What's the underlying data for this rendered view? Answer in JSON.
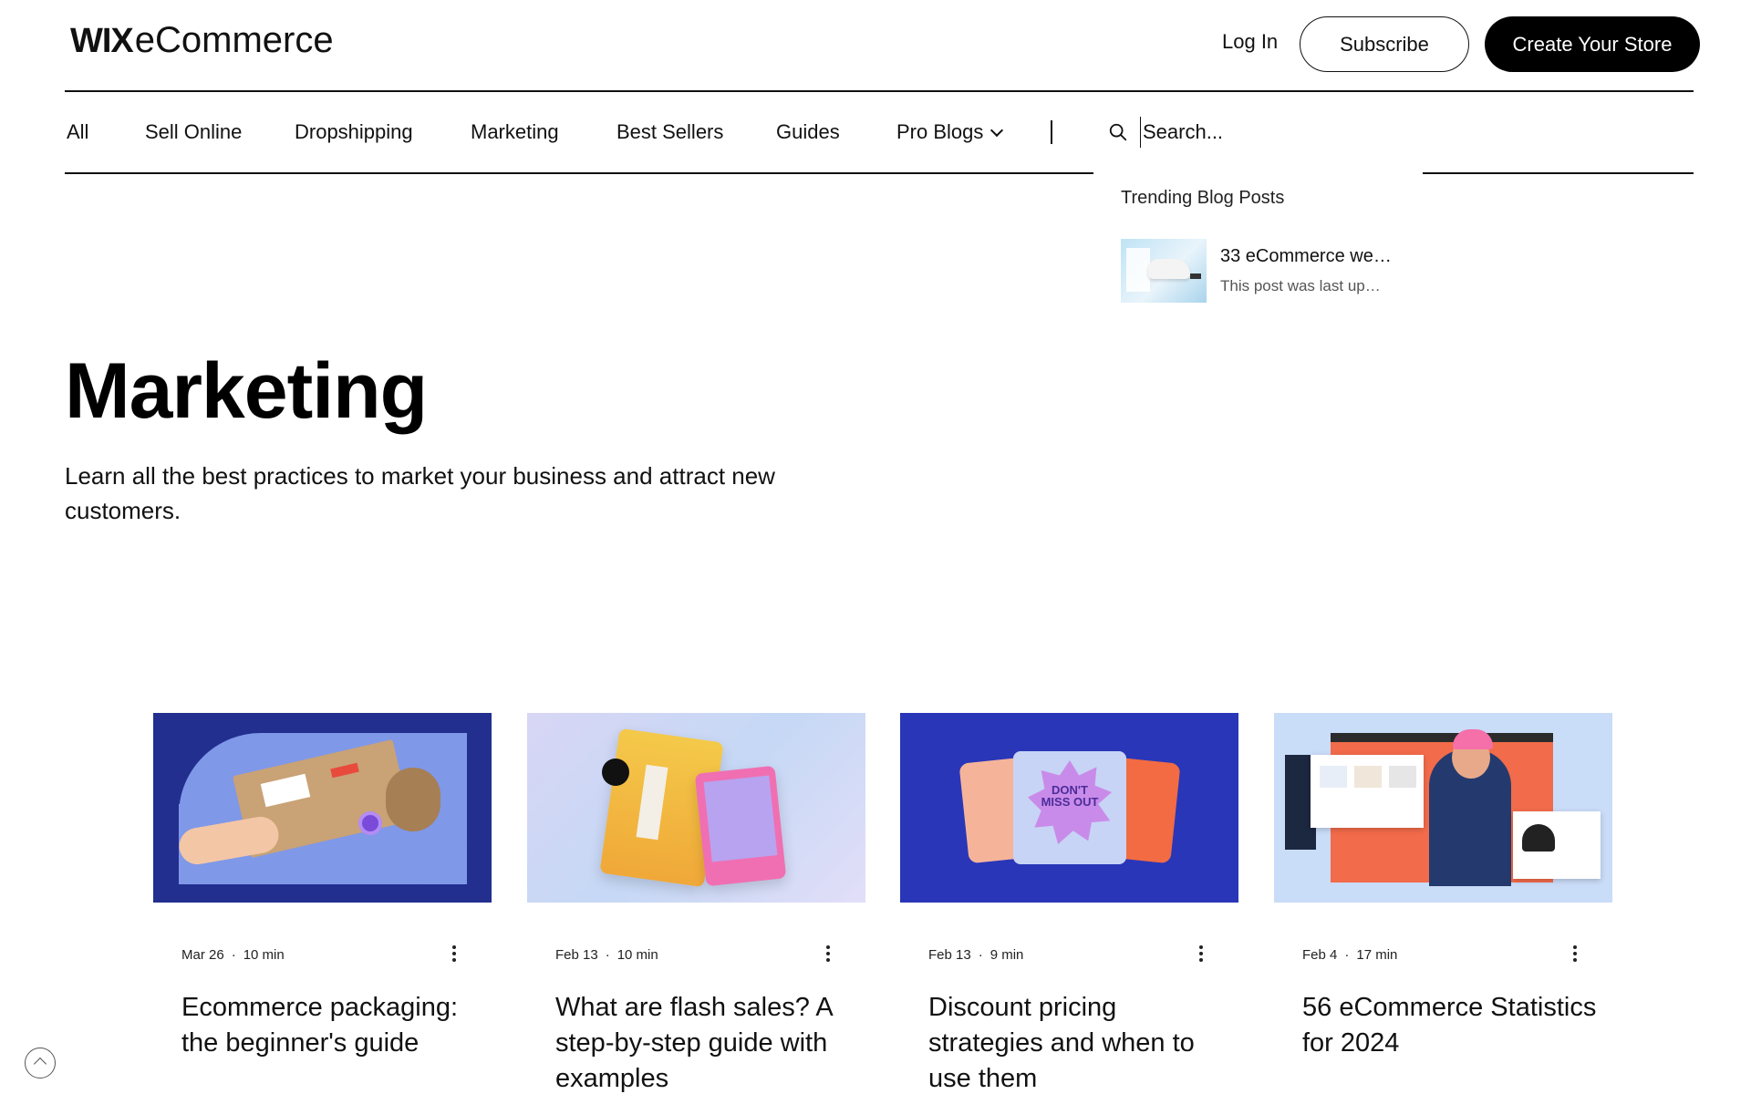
{
  "header": {
    "logo_wix": "WIX",
    "logo_ecommerce": "eCommerce",
    "login_label": "Log In",
    "subscribe_label": "Subscribe",
    "create_store_label": "Create Your Store"
  },
  "nav": {
    "items": [
      {
        "label": "All"
      },
      {
        "label": "Sell Online"
      },
      {
        "label": "Dropshipping"
      },
      {
        "label": "Marketing"
      },
      {
        "label": "Best Sellers"
      },
      {
        "label": "Guides"
      },
      {
        "label": "Pro Blogs"
      }
    ],
    "search_placeholder": "Search..."
  },
  "trending": {
    "title": "Trending Blog Posts",
    "posts": [
      {
        "title": "33 eCommerce we…",
        "excerpt": "This post was last up…"
      }
    ]
  },
  "hero": {
    "title": "Marketing",
    "description": "Learn all the best practices to market your business and attract new customers."
  },
  "posts": [
    {
      "date": "Mar 26",
      "read_time": "10 min",
      "title": "Ecommerce packaging: the beginner's guide"
    },
    {
      "date": "Feb 13",
      "read_time": "10 min",
      "title": "What are flash sales? A step-by-step guide with examples"
    },
    {
      "date": "Feb 13",
      "read_time": "9 min",
      "title": "Discount pricing strategies and when to use them"
    },
    {
      "date": "Feb 4",
      "read_time": "17 min",
      "title": "56 eCommerce Statistics for 2024"
    }
  ],
  "card3_art_text": "DON'T MISS OUT",
  "icons": {
    "search": "search-icon",
    "chevron": "chevron-down-icon",
    "more": "more-vertical-icon",
    "back_to_top": "chevron-up-icon"
  }
}
